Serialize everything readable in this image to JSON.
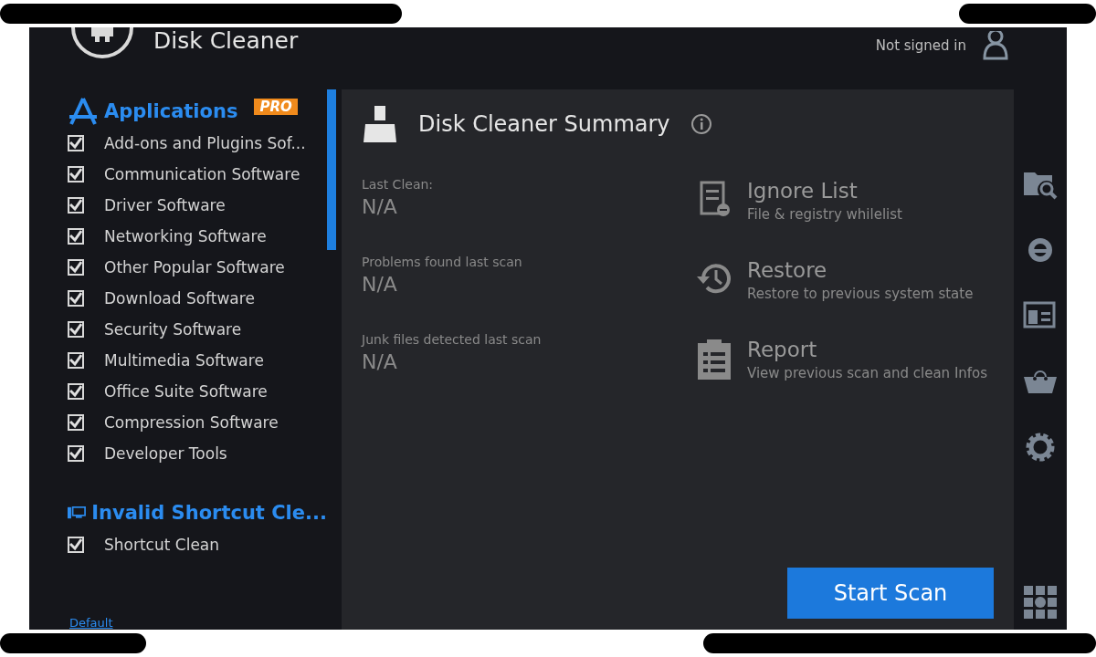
{
  "window": {
    "title": "Disk Cleaner"
  },
  "account": {
    "status": "Not signed in"
  },
  "sidebar": {
    "groups": [
      {
        "kind": "apps",
        "title": "Applications",
        "badge": "PRO",
        "items": [
          {
            "label": "Add-ons and Plugins Sof...",
            "checked": true
          },
          {
            "label": "Communication Software",
            "checked": true
          },
          {
            "label": "Driver Software",
            "checked": true
          },
          {
            "label": "Networking Software",
            "checked": true
          },
          {
            "label": "Other Popular Software",
            "checked": true
          },
          {
            "label": "Download Software",
            "checked": true
          },
          {
            "label": "Security Software",
            "checked": true
          },
          {
            "label": "Multimedia Software",
            "checked": true
          },
          {
            "label": "Office Suite Software",
            "checked": true
          },
          {
            "label": "Compression Software",
            "checked": true
          },
          {
            "label": "Developer Tools",
            "checked": true
          }
        ]
      },
      {
        "kind": "shortcut",
        "title": "Invalid Shortcut Cle...",
        "items": [
          {
            "label": "Shortcut Clean",
            "checked": true
          }
        ]
      }
    ],
    "footer_link": "Default"
  },
  "summary": {
    "title": "Disk Cleaner Summary",
    "stats": [
      {
        "label": "Last Clean:",
        "value": "N/A"
      },
      {
        "label": "Problems found last scan",
        "value": "N/A"
      },
      {
        "label": "Junk files detected last scan",
        "value": "N/A"
      }
    ],
    "actions": [
      {
        "kind": "ignore",
        "title": "Ignore List",
        "description": "File & registry whilelist"
      },
      {
        "kind": "restore",
        "title": "Restore",
        "description": "Restore to previous system state"
      },
      {
        "kind": "report",
        "title": "Report",
        "description": "View previous scan and clean Infos"
      }
    ],
    "button": "Start Scan"
  }
}
